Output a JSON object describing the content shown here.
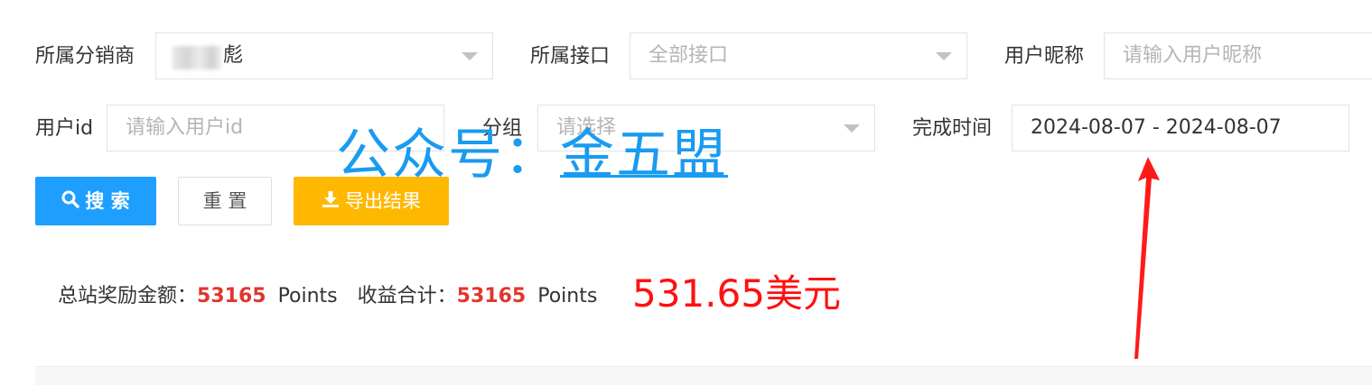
{
  "filters": {
    "distributor": {
      "label": "所属分销商",
      "value": "彪"
    },
    "interface": {
      "label": "所属接口",
      "placeholder": "全部接口"
    },
    "nickname": {
      "label": "用户昵称",
      "placeholder": "请输入用户昵称"
    },
    "user_id": {
      "label": "用户id",
      "placeholder": "请输入用户id"
    },
    "group": {
      "label": "分组",
      "placeholder": "请选择"
    },
    "finish_time": {
      "label": "完成时间",
      "value": "2024-08-07 - 2024-08-07"
    }
  },
  "buttons": {
    "search": "搜 索",
    "reset": "重 置",
    "export": "导出结果"
  },
  "summary": {
    "reward_label": "总站奖励金额：",
    "reward_value": "53165",
    "reward_unit": "Points",
    "income_label": "收益合计：",
    "income_value": "53165",
    "income_unit": "Points"
  },
  "annotations": {
    "usd_amount": "531.65美元",
    "watermark_prefix": "公众号：",
    "watermark_name": "金五盟"
  },
  "colors": {
    "primary": "#1e9fff",
    "warning": "#ffb800",
    "highlight_red": "#e0362d",
    "annotation_red": "#ff1010",
    "watermark_blue": "#1a9bf0"
  },
  "icons": {
    "search": "search-icon",
    "export": "download-icon",
    "dropdown": "caret-down-icon",
    "annotation": "red-arrow-icon"
  }
}
